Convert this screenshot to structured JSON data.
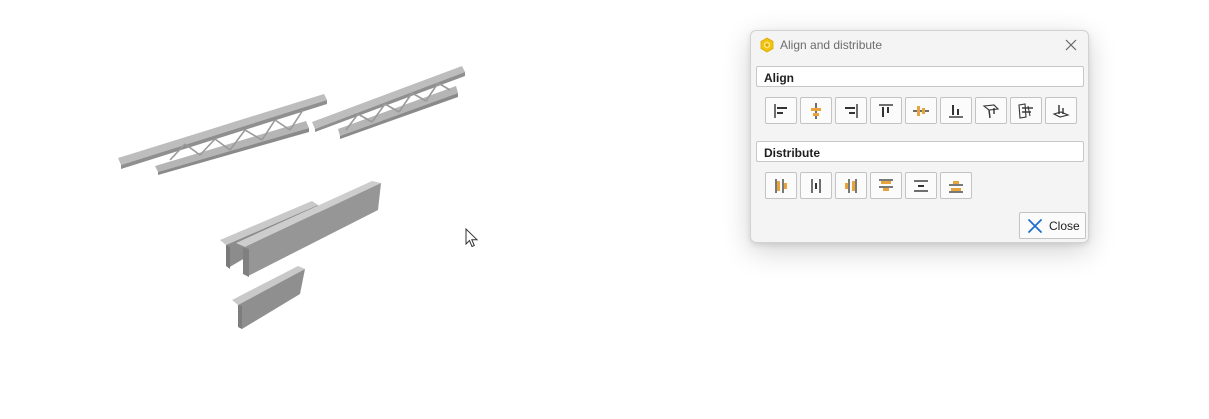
{
  "dialog": {
    "title": "Align and distribute",
    "accent_color": "#f2c40f",
    "close_icon_color": "#1e6fd0",
    "align": {
      "header": "Align",
      "buttons": [
        {
          "icon": "align-left-icon"
        },
        {
          "icon": "align-center-horizontal-icon"
        },
        {
          "icon": "align-right-icon"
        },
        {
          "icon": "align-top-icon"
        },
        {
          "icon": "align-middle-vertical-icon"
        },
        {
          "icon": "align-bottom-icon"
        },
        {
          "icon": "align-plane-3d-icon"
        },
        {
          "icon": "align-depth-3d-icon"
        },
        {
          "icon": "align-surface-3d-icon"
        }
      ]
    },
    "distribute": {
      "header": "Distribute",
      "buttons": [
        {
          "icon": "distribute-left-icon"
        },
        {
          "icon": "distribute-horizontal-center-icon"
        },
        {
          "icon": "distribute-right-icon"
        },
        {
          "icon": "distribute-top-icon"
        },
        {
          "icon": "distribute-vertical-center-icon"
        },
        {
          "icon": "distribute-bottom-icon"
        }
      ]
    },
    "close_label": "Close"
  }
}
